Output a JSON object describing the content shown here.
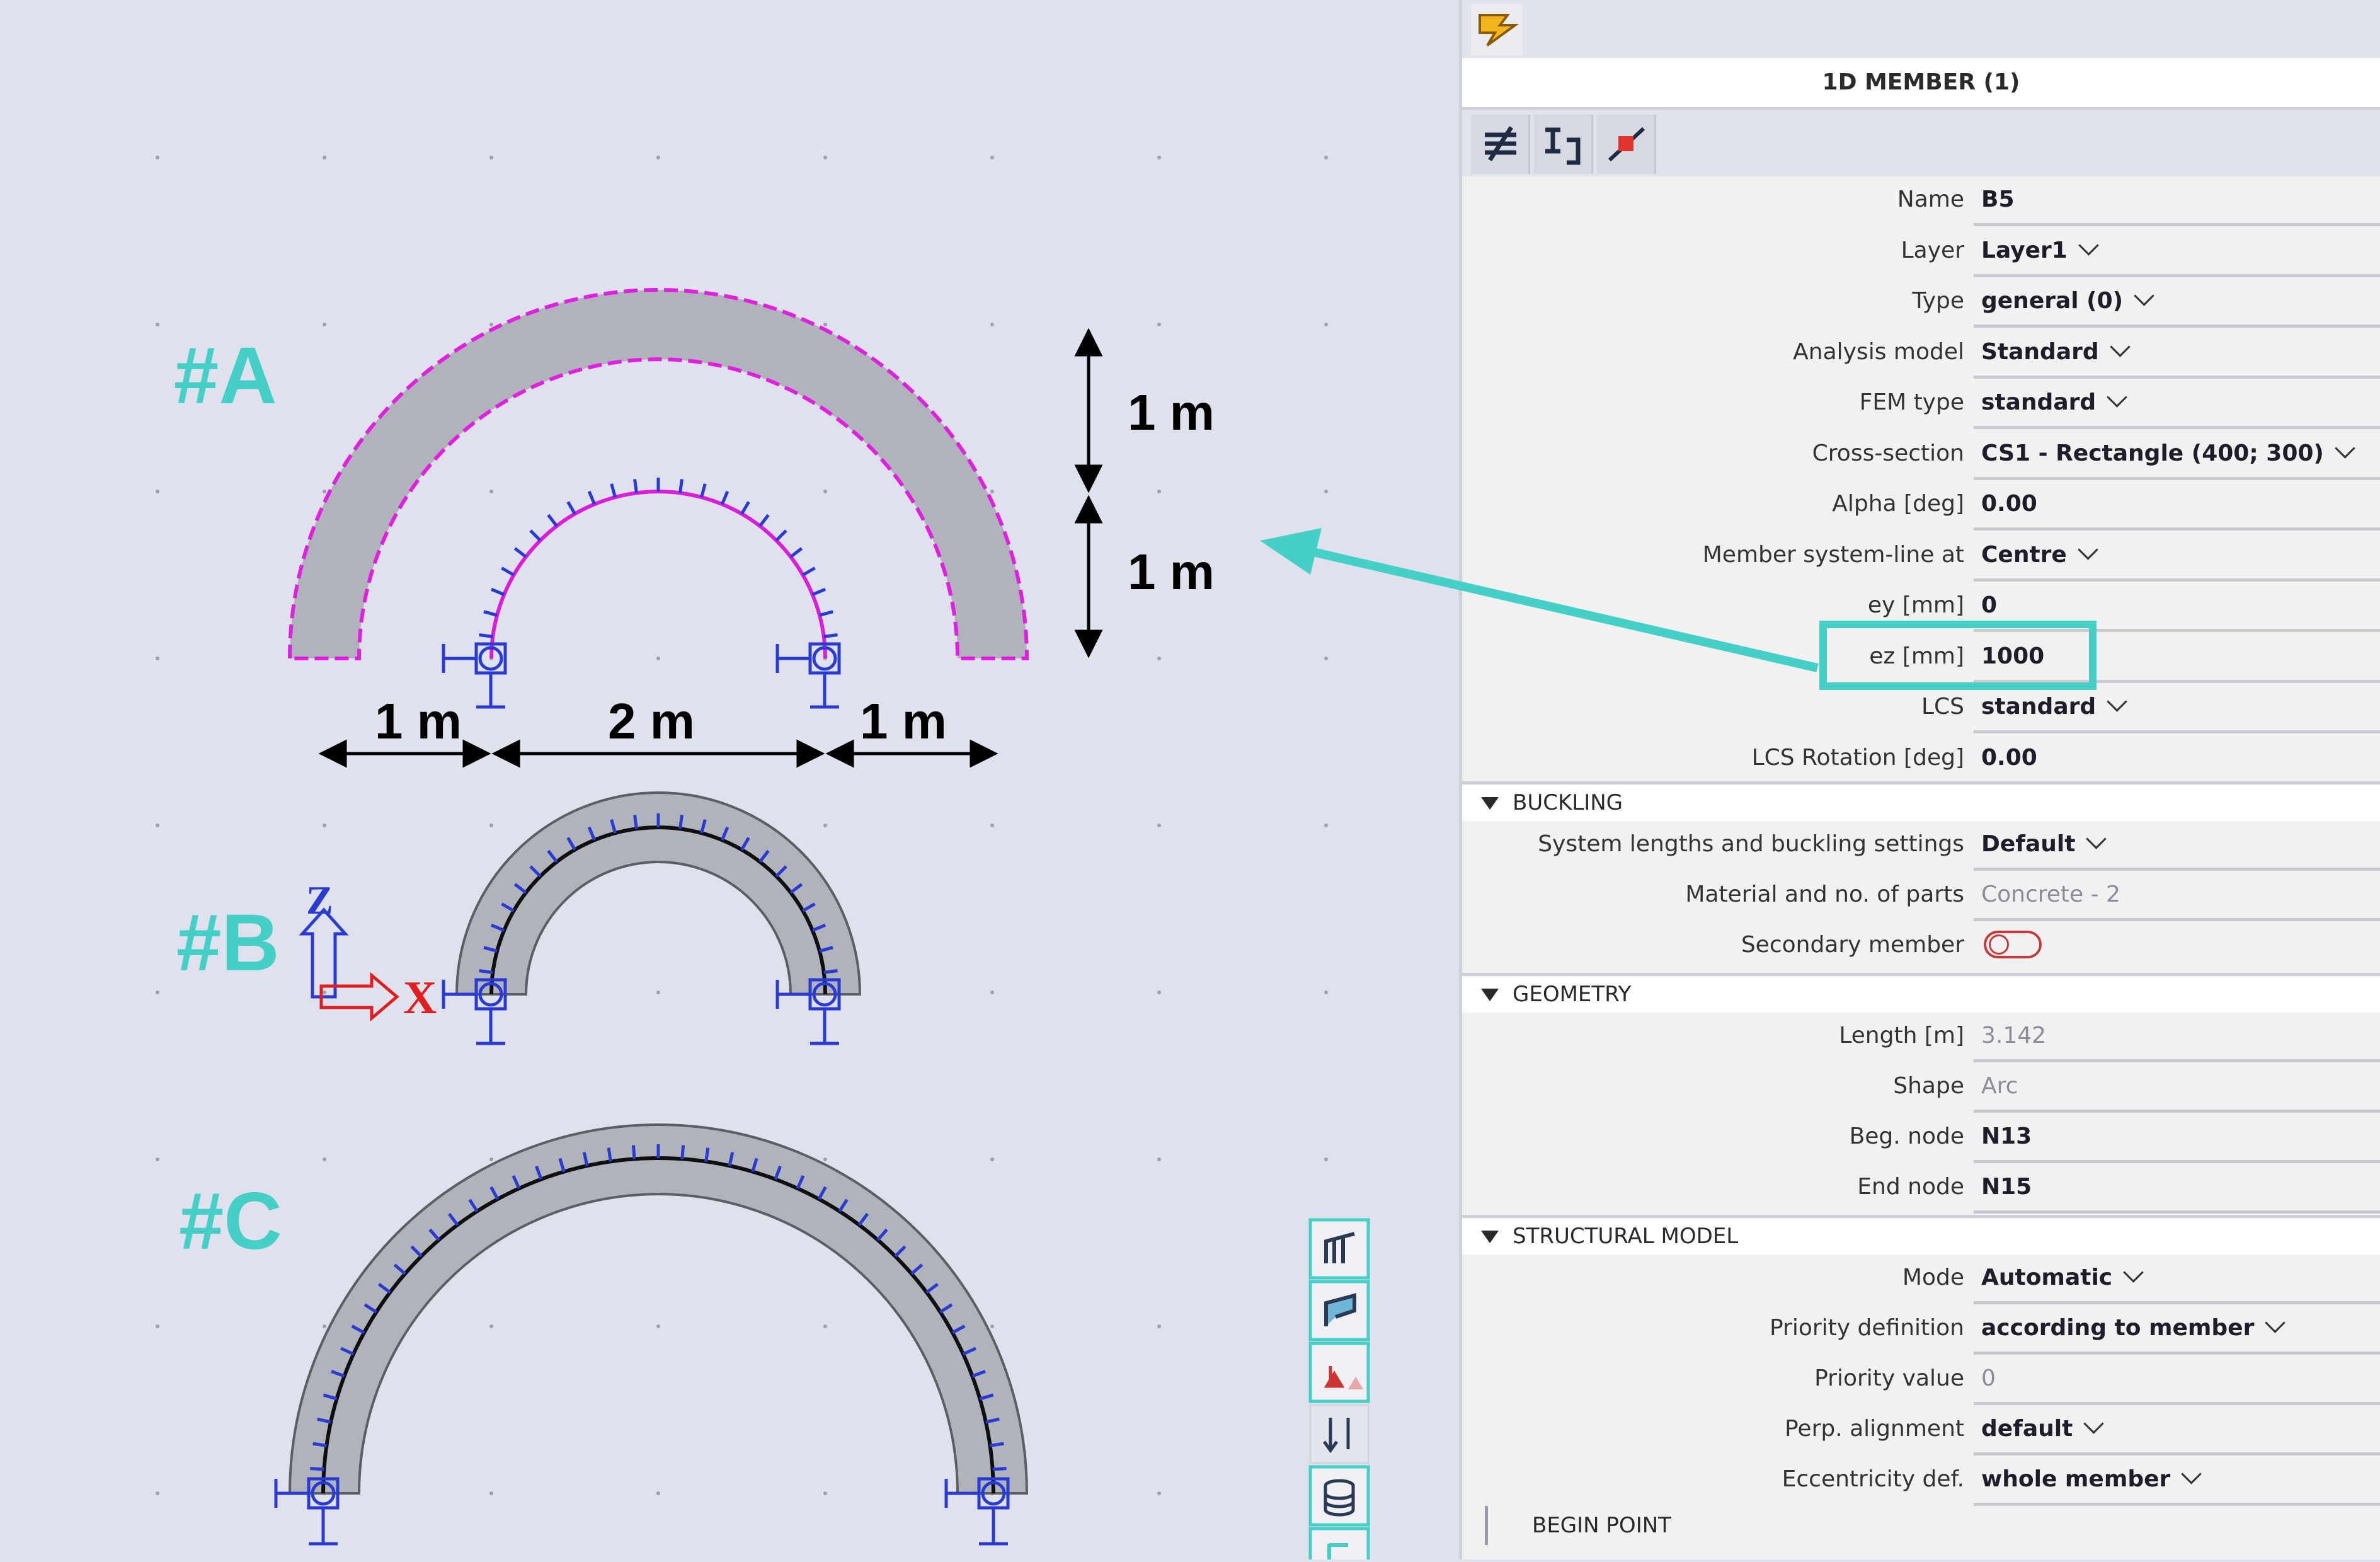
{
  "diagram": {
    "labels": {
      "a": "#A",
      "b": "#B",
      "c": "#C"
    },
    "dimensions": {
      "vertical_top": "1 m",
      "vertical_bottom": "1 m",
      "horizontal_left": "1 m",
      "horizontal_middle": "2 m",
      "horizontal_right": "1 m"
    },
    "axes": {
      "z": "Z",
      "x": "X"
    },
    "colors": {
      "label": "#45cfc7",
      "outline": "#e020e0",
      "member": "#b1b3ba",
      "support": "#2a3bd1",
      "arrow": "#45cfc7"
    }
  },
  "panel": {
    "title": "1D MEMBER (1)",
    "tool_icons": [
      "layers-icon",
      "cross-section-icon",
      "node-icon"
    ],
    "properties": [
      {
        "key": "name",
        "label": "Name",
        "value": "B5",
        "dropdown": false
      },
      {
        "key": "layer",
        "label": "Layer",
        "value": "Layer1",
        "dropdown": true
      },
      {
        "key": "type",
        "label": "Type",
        "value": "general (0)",
        "dropdown": true
      },
      {
        "key": "analysis",
        "label": "Analysis model",
        "value": "Standard",
        "dropdown": true
      },
      {
        "key": "fem",
        "label": "FEM type",
        "value": "standard",
        "dropdown": true
      },
      {
        "key": "cs",
        "label": "Cross-section",
        "value": "CS1 - Rectangle (400; 300)",
        "dropdown": true
      },
      {
        "key": "alpha",
        "label": "Alpha [deg]",
        "value": "0.00",
        "dropdown": false
      },
      {
        "key": "sysline",
        "label": "Member system-line at",
        "value": "Centre",
        "dropdown": true
      },
      {
        "key": "ey",
        "label": "ey [mm]",
        "value": "0",
        "dropdown": false
      },
      {
        "key": "ez",
        "label": "ez [mm]",
        "value": "1000",
        "dropdown": false
      },
      {
        "key": "lcs",
        "label": "LCS",
        "value": "standard",
        "dropdown": true
      },
      {
        "key": "lcsrot",
        "label": "LCS Rotation [deg]",
        "value": "0.00",
        "dropdown": false
      }
    ],
    "buckling": {
      "title": "BUCKLING",
      "system_lengths": {
        "label": "System lengths and buckling settings",
        "value": "Default"
      },
      "material": {
        "label": "Material and no. of parts",
        "value": "Concrete - 2"
      },
      "secondary": {
        "label": "Secondary member",
        "on": false
      }
    },
    "geometry": {
      "title": "GEOMETRY",
      "length": {
        "label": "Length [m]",
        "value": "3.142"
      },
      "shape": {
        "label": "Shape",
        "value": "Arc"
      },
      "beg_node": {
        "label": "Beg. node",
        "value": "N13"
      },
      "end_node": {
        "label": "End node",
        "value": "N15"
      }
    },
    "structural": {
      "title": "STRUCTURAL MODEL",
      "mode": {
        "label": "Mode",
        "value": "Automatic"
      },
      "priority_def": {
        "label": "Priority definition",
        "value": "according to member"
      },
      "priority_val": {
        "label": "Priority value",
        "value": "0"
      },
      "perp": {
        "label": "Perp. alignment",
        "value": "default"
      },
      "ecc": {
        "label": "Eccentricity def.",
        "value": "whole member"
      }
    },
    "begin_point": "BEGIN POINT"
  }
}
